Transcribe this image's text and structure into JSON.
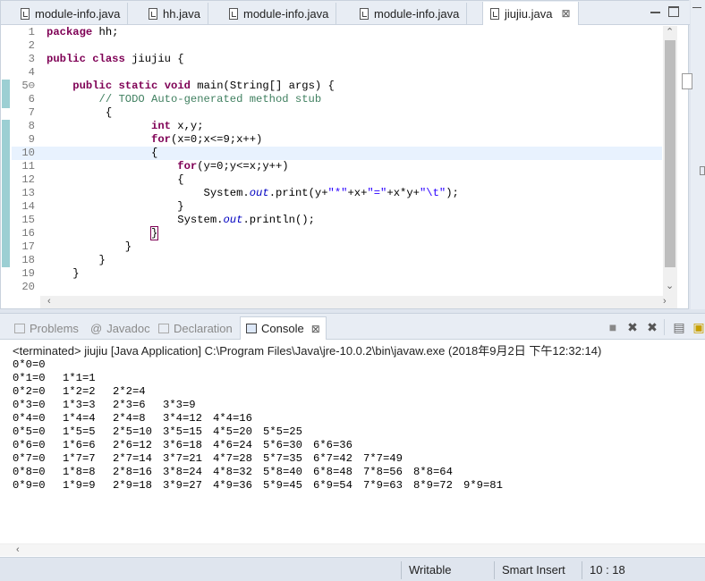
{
  "tabs": [
    {
      "label": "module-info.java"
    },
    {
      "label": "hh.java"
    },
    {
      "label": "module-info.java"
    },
    {
      "label": "module-info.java"
    },
    {
      "label": "jiujiu.java",
      "close": "⊠"
    }
  ],
  "editor": {
    "lines": [
      {
        "n": "1",
        "html": "<span class='kw'>package</span> hh;"
      },
      {
        "n": "2",
        "html": ""
      },
      {
        "n": "3",
        "html": "<span class='kw'>public</span> <span class='kw'>class</span> jiujiu {"
      },
      {
        "n": "4",
        "html": ""
      },
      {
        "n": "5⊖",
        "html": "    <span class='kw'>public</span> <span class='kw'>static</span> <span class='kw'>void</span> main(String[] args) {"
      },
      {
        "n": "6",
        "html": "        <span class='cm'>// TODO Auto-generated method stub</span>"
      },
      {
        "n": "7",
        "html": "         {"
      },
      {
        "n": "8",
        "html": "                <span class='kw'>int</span> x,y;"
      },
      {
        "n": "9",
        "html": "                <span class='kw'>for</span>(x=0;x<=9;x++)"
      },
      {
        "n": "10",
        "html": "                {"
      },
      {
        "n": "11",
        "html": "                    <span class='kw'>for</span>(y=0;y<=x;y++)"
      },
      {
        "n": "12",
        "html": "                    {"
      },
      {
        "n": "13",
        "html": "                        System.<span class='fl'>out</span>.print(y+<span class='st'>\"*\"</span>+x+<span class='st'>\"=\"</span>+x*y+<span class='st'>\"\\t\"</span>);"
      },
      {
        "n": "14",
        "html": "                    }"
      },
      {
        "n": "15",
        "html": "                    System.<span class='fl'>out</span>.println();"
      },
      {
        "n": "16",
        "html": "                <span style='outline:1px solid #7f0055'>}</span>"
      },
      {
        "n": "17",
        "html": "            }"
      },
      {
        "n": "18",
        "html": "        }"
      },
      {
        "n": "19",
        "html": "    }"
      },
      {
        "n": "20",
        "html": ""
      }
    ]
  },
  "console_tabs": [
    {
      "label": "Problems"
    },
    {
      "label": "Javadoc"
    },
    {
      "label": "Declaration"
    },
    {
      "label": "Console",
      "close": "⊠"
    }
  ],
  "console": {
    "status": "<terminated> jiujiu [Java Application] C:\\Program Files\\Java\\jre-10.0.2\\bin\\javaw.exe (2018年9月2日 下午12:32:14)",
    "output": "0*0=0\n0*1=0\t1*1=1\n0*2=0\t1*2=2\t2*2=4\n0*3=0\t1*3=3\t2*3=6\t3*3=9\n0*4=0\t1*4=4\t2*4=8\t3*4=12\t4*4=16\n0*5=0\t1*5=5\t2*5=10\t3*5=15\t4*5=20\t5*5=25\n0*6=0\t1*6=6\t2*6=12\t3*6=18\t4*6=24\t5*6=30\t6*6=36\n0*7=0\t1*7=7\t2*7=14\t3*7=21\t4*7=28\t5*7=35\t6*7=42\t7*7=49\n0*8=0\t1*8=8\t2*8=16\t3*8=24\t4*8=32\t5*8=40\t6*8=48\t7*8=56\t8*8=64\n0*9=0\t1*9=9\t2*9=18\t3*9=27\t4*9=36\t5*9=45\t6*9=54\t7*9=63\t8*9=72\t9*9=81"
  },
  "statusbar": {
    "writable": "Writable",
    "insert_mode": "Smart Insert",
    "position": "10 : 18"
  }
}
